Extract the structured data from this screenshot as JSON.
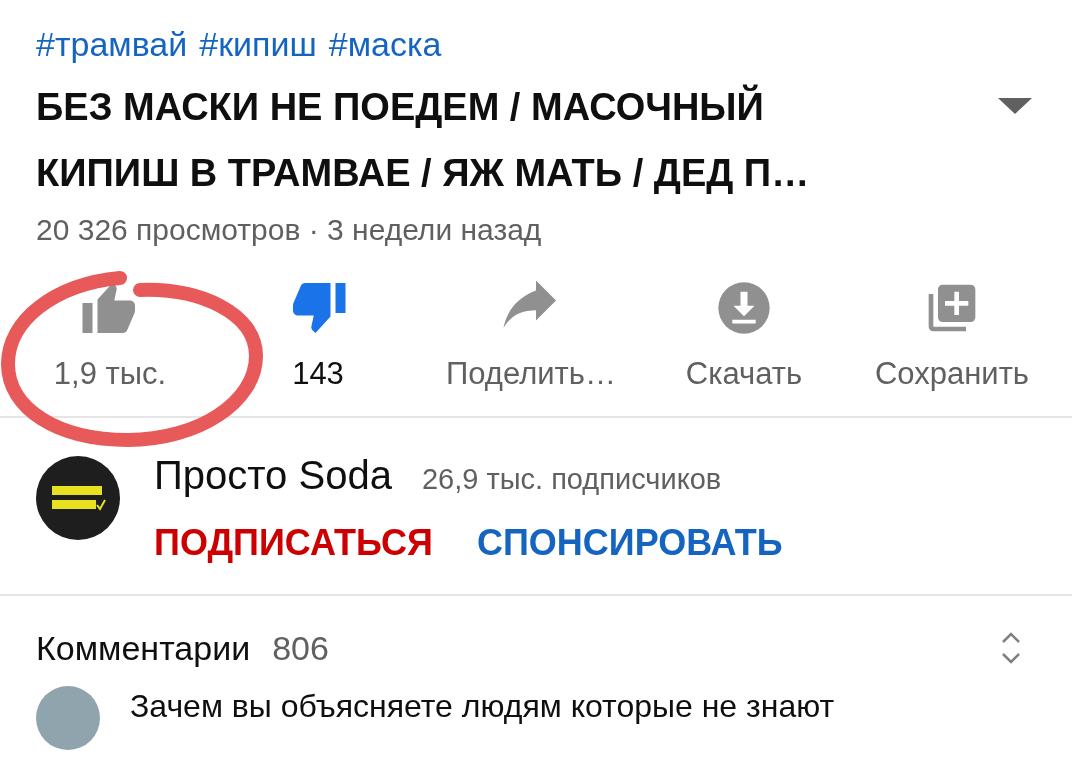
{
  "hashtags": [
    "#трамвай",
    "#кипиш",
    "#маска"
  ],
  "title": "БЕЗ МАСКИ НЕ ПОЕДЕМ / МАСОЧНЫЙ КИПИШ В ТРАМВАЕ / ЯЖ МАТЬ / ДЕД П…",
  "meta": "20 326 просмотров · 3 недели назад",
  "actions": [
    {
      "kind": "like",
      "label": "1,9 тыс.",
      "selected": false
    },
    {
      "kind": "dislike",
      "label": "143",
      "selected": true
    },
    {
      "kind": "share",
      "label": "Поделить…",
      "selected": false
    },
    {
      "kind": "download",
      "label": "Скачать",
      "selected": false
    },
    {
      "kind": "save",
      "label": "Сохранить",
      "selected": false
    }
  ],
  "channel": {
    "name": "Просто Soda",
    "subscribers": "26,9 тыс. подписчиков",
    "subscribe": "ПОДПИСАТЬСЯ",
    "sponsor": "СПОНСИРОВАТЬ"
  },
  "comments": {
    "title": "Комментарии",
    "count": "806",
    "preview": "Зачем вы объясняете людям которые не знают"
  }
}
